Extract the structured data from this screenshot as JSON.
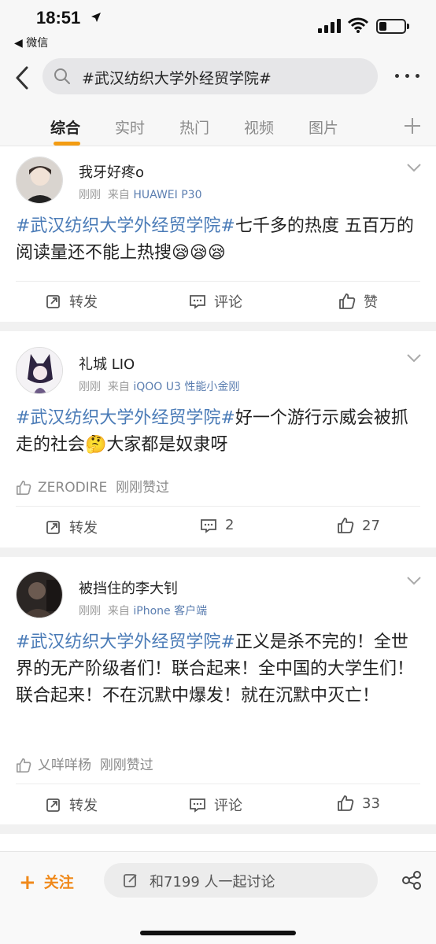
{
  "status": {
    "time": "18:51",
    "back_app": "◀ 微信"
  },
  "search": {
    "query": "#武汉纺织大学外经贸学院#"
  },
  "tabs": [
    {
      "label": "综合",
      "active": true
    },
    {
      "label": "实时"
    },
    {
      "label": "热门"
    },
    {
      "label": "视频"
    },
    {
      "label": "图片"
    }
  ],
  "posts": [
    {
      "username": "我牙好疼o",
      "time": "刚刚",
      "from": "来自",
      "source": "HUAWEI P30",
      "hashtag": "#武汉纺织大学外经贸学院#",
      "text": "七千多的热度 五百万的阅读量还不能上热搜😪😪😪",
      "repost": "转发",
      "comment": "评论",
      "like": "赞"
    },
    {
      "username": "礼城 LIO",
      "time": "刚刚",
      "from": "来自",
      "source": "iQOO U3 性能小金刚",
      "hashtag": "#武汉纺织大学外经贸学院#",
      "text": "好一个游行示威会被抓走的社会🤔大家都是奴隶呀",
      "liked_by": "ZERODIRE",
      "liked_text": "刚刚赞过",
      "repost": "转发",
      "comment": "2",
      "like": "27"
    },
    {
      "username": "被挡住的李大钊",
      "time": "刚刚",
      "from": "来自",
      "source": "iPhone 客户端",
      "hashtag": "#武汉纺织大学外经贸学院#",
      "text": "正义是杀不完的！全世界的无产阶级者们！联合起来！全中国的大学生们！联合起来！不在沉默中爆发！就在沉默中灭亡！",
      "liked_by": "乂咩咩杨",
      "liked_text": "刚刚赞过",
      "repost": "转发",
      "comment": "评论",
      "like": "33"
    }
  ],
  "bottom": {
    "follow": "关注",
    "plus": "+",
    "discuss": "和7199 人一起讨论"
  },
  "colors": {
    "accent": "#f39c12",
    "link": "#4a7bb7"
  }
}
